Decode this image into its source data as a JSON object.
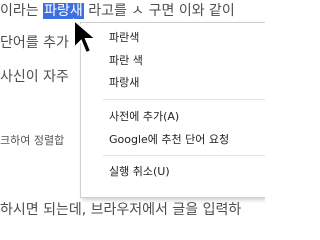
{
  "text": {
    "line1_before": "이라는",
    "line1_highlight": "파랑새",
    "line1_after": "라고를 ㅅ 구면 이와 같이",
    "line2": "단어를 추가",
    "line3": "사신이 자주",
    "line4": "크하여 정렬합",
    "line5": "하시면 되는데, 브라우저에서 글을 입력하",
    "orange_glyph": "ㄴ"
  },
  "menu": {
    "suggestions": [
      "파란색",
      "파란 색",
      "파랑새"
    ],
    "add_to_dictionary": "사전에 추가(A)",
    "suggest_to_google": "Google에 추천 단어 요청",
    "undo": "실행 취소(U)"
  }
}
